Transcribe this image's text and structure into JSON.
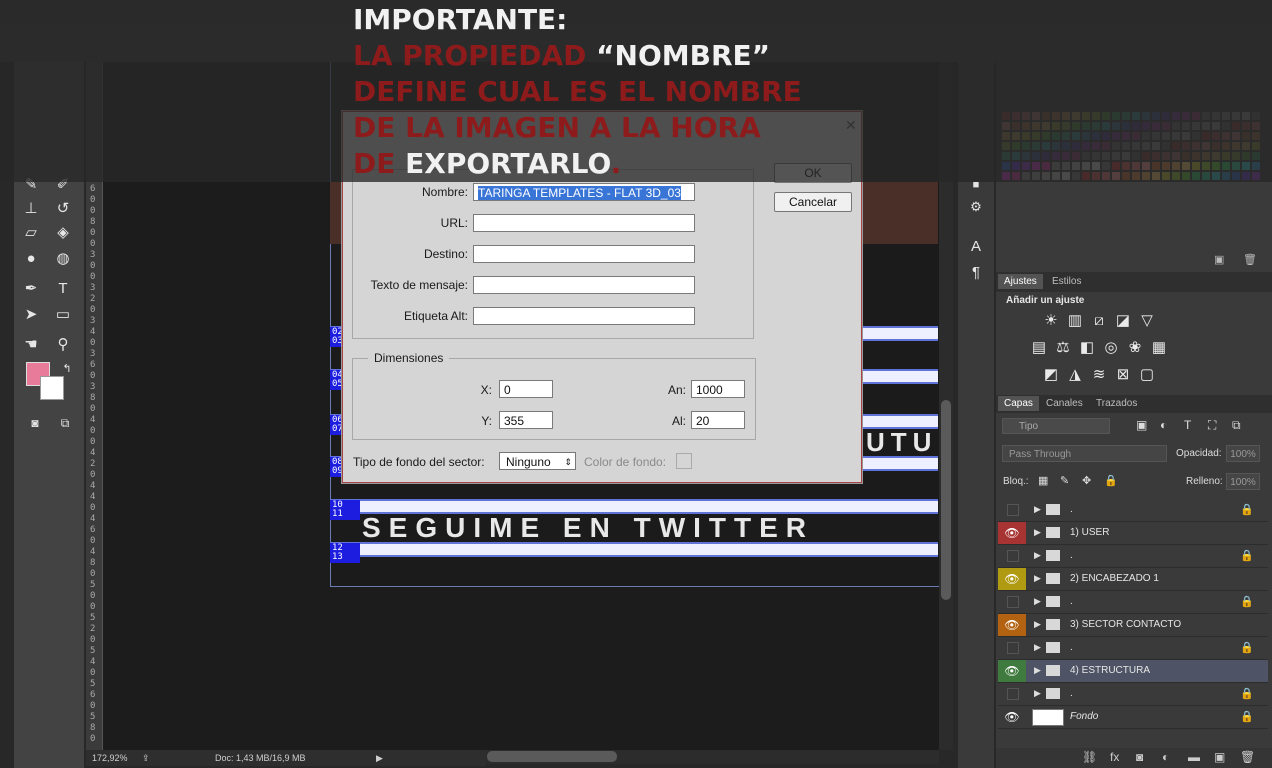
{
  "overlay": {
    "line1": "IMPORTANTE:",
    "line2a": "LA PROPIEDAD ",
    "line2b": "“NOMBRE”",
    "line3": "DEFINE CUAL ES EL NOMBRE",
    "line4": "DE LA IMAGEN A LA HORA",
    "line5a": "DE ",
    "line5b": "EXPORTARLO",
    "line5c": "."
  },
  "dialog": {
    "nombre_label": "Nombre:",
    "nombre_value": "TARINGA TEMPLATES - FLAT 3D_03",
    "url_label": "URL:",
    "url_value": "",
    "destino_label": "Destino:",
    "destino_value": "",
    "texto_label": "Texto de mensaje:",
    "texto_value": "",
    "alt_label": "Etiqueta Alt:",
    "alt_value": "",
    "dimensiones_label": "Dimensiones",
    "x_label": "X:",
    "x_value": "0",
    "y_label": "Y:",
    "y_value": "355",
    "an_label": "An:",
    "an_value": "1000",
    "al_label": "Al:",
    "al_value": "20",
    "fondo_label": "Tipo de fondo del sector:",
    "fondo_value": "Ninguno",
    "color_label": "Color de fondo:",
    "ok_label": "OK",
    "cancel_label": "Cancelar"
  },
  "canvas": {
    "twitter_text": "SEGUIME EN TWITTER",
    "tutu_text": "UTU",
    "slices": [
      "02\n03",
      "04\n05",
      "06\n07",
      "08\n09",
      "10\n11",
      "12\n13"
    ]
  },
  "status": {
    "zoom": "172,92%",
    "doc": "Doc: 1,43 MB/16,9 MB"
  },
  "panels": {
    "tab_ajustes": "Ajustes",
    "tab_estilos": "Estilos",
    "add_adjust": "Añadir un ajuste",
    "tab_capas": "Capas",
    "tab_canales": "Canales",
    "tab_trazados": "Trazados",
    "filter_kind": "Tipo",
    "blend_mode": "Pass Through",
    "opacity_label": "Opacidad:",
    "opacity_value": "100%",
    "lock_label": "Bloq.:",
    "fill_label": "Relleno:",
    "fill_value": "100%"
  },
  "layers": [
    {
      "name": ".",
      "visible": false,
      "locked": true,
      "color": ""
    },
    {
      "name": "1) USER",
      "visible": true,
      "locked": false,
      "color": "#a83333"
    },
    {
      "name": ".",
      "visible": false,
      "locked": true,
      "color": ""
    },
    {
      "name": "2) ENCABEZADO 1",
      "visible": true,
      "locked": false,
      "color": "#b09a12"
    },
    {
      "name": ".",
      "visible": false,
      "locked": true,
      "color": ""
    },
    {
      "name": "3) SECTOR CONTACTO",
      "visible": true,
      "locked": false,
      "color": "#b36211"
    },
    {
      "name": ".",
      "visible": false,
      "locked": true,
      "color": ""
    },
    {
      "name": "4) ESTRUCTURA",
      "visible": true,
      "locked": false,
      "color": "#3f7a3f"
    },
    {
      "name": ".",
      "visible": false,
      "locked": true,
      "color": ""
    },
    {
      "name": "Fondo",
      "visible": true,
      "locked": true,
      "color": ""
    }
  ],
  "colors": {
    "foreground": "#e87b9a",
    "background": "#ffffff"
  }
}
